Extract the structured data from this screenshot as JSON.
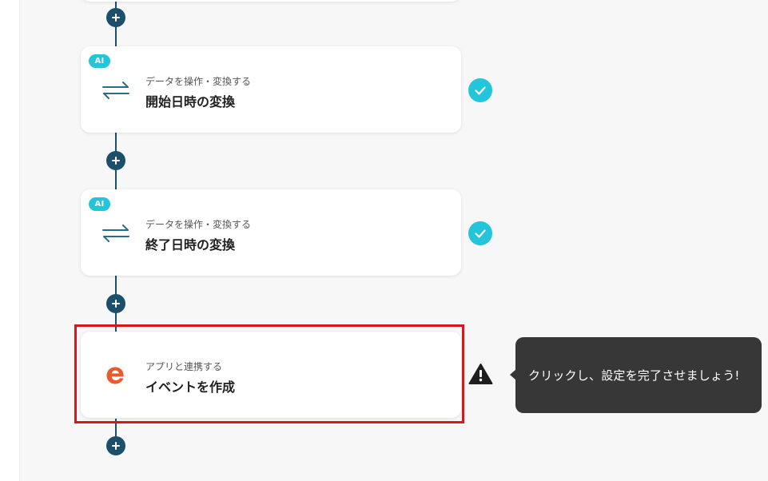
{
  "flow": {
    "steps": [
      {
        "badge": "AI",
        "icon": "swap-arrows-icon",
        "subtitle": "データを操作・変換する",
        "title": "開始日時の変換",
        "status": "completed"
      },
      {
        "badge": "AI",
        "icon": "swap-arrows-icon",
        "subtitle": "データを操作・変換する",
        "title": "終了日時の変換",
        "status": "completed"
      },
      {
        "badge": "",
        "icon": "eventbrite-logo-icon",
        "subtitle": "アプリと連携する",
        "title": "イベントを作成",
        "status": "warning"
      }
    ],
    "tooltip": "クリックし、設定を完了させましょう!"
  },
  "colors": {
    "canvas": "#f7f7f7",
    "flow_line": "#1b4f6b",
    "check": "#22c5da",
    "ai_badge": "#22c5da",
    "highlight_border": "#d8161b",
    "tooltip_bg": "#373737",
    "app_logo": "#ec5a2b"
  }
}
